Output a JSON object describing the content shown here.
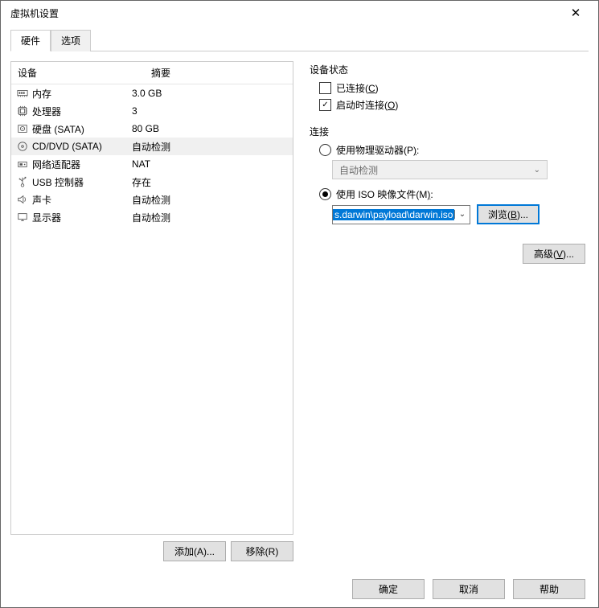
{
  "window": {
    "title": "虚拟机设置",
    "close": "✕"
  },
  "tabs": {
    "hardware": "硬件",
    "options": "选项"
  },
  "table": {
    "hdr_device": "设备",
    "hdr_summary": "摘要",
    "rows": [
      {
        "icon": "memory",
        "name": "内存",
        "summary": "3.0 GB",
        "sel": false
      },
      {
        "icon": "cpu",
        "name": "处理器",
        "summary": "3",
        "sel": false
      },
      {
        "icon": "disk",
        "name": "硬盘 (SATA)",
        "summary": "80 GB",
        "sel": false
      },
      {
        "icon": "cd",
        "name": "CD/DVD (SATA)",
        "summary": "自动检测",
        "sel": true
      },
      {
        "icon": "net",
        "name": "网络适配器",
        "summary": "NAT",
        "sel": false
      },
      {
        "icon": "usb",
        "name": "USB 控制器",
        "summary": "存在",
        "sel": false
      },
      {
        "icon": "sound",
        "name": "声卡",
        "summary": "自动检测",
        "sel": false
      },
      {
        "icon": "display",
        "name": "显示器",
        "summary": "自动检测",
        "sel": false
      }
    ]
  },
  "left_buttons": {
    "add": "添加(A)...",
    "remove": "移除(R)"
  },
  "right": {
    "status_title": "设备状态",
    "connected": "已连接(C)",
    "connect_on_power": "启动时连接(O)",
    "connection_title": "连接",
    "use_physical": "使用物理驱动器(P):",
    "auto_detect": "自动检测",
    "use_iso": "使用 ISO 映像文件(M):",
    "iso_path": "s.darwin\\payload\\darwin.iso",
    "browse": "浏览(B)...",
    "advanced": "高级(V)..."
  },
  "footer": {
    "ok": "确定",
    "cancel": "取消",
    "help": "帮助"
  }
}
